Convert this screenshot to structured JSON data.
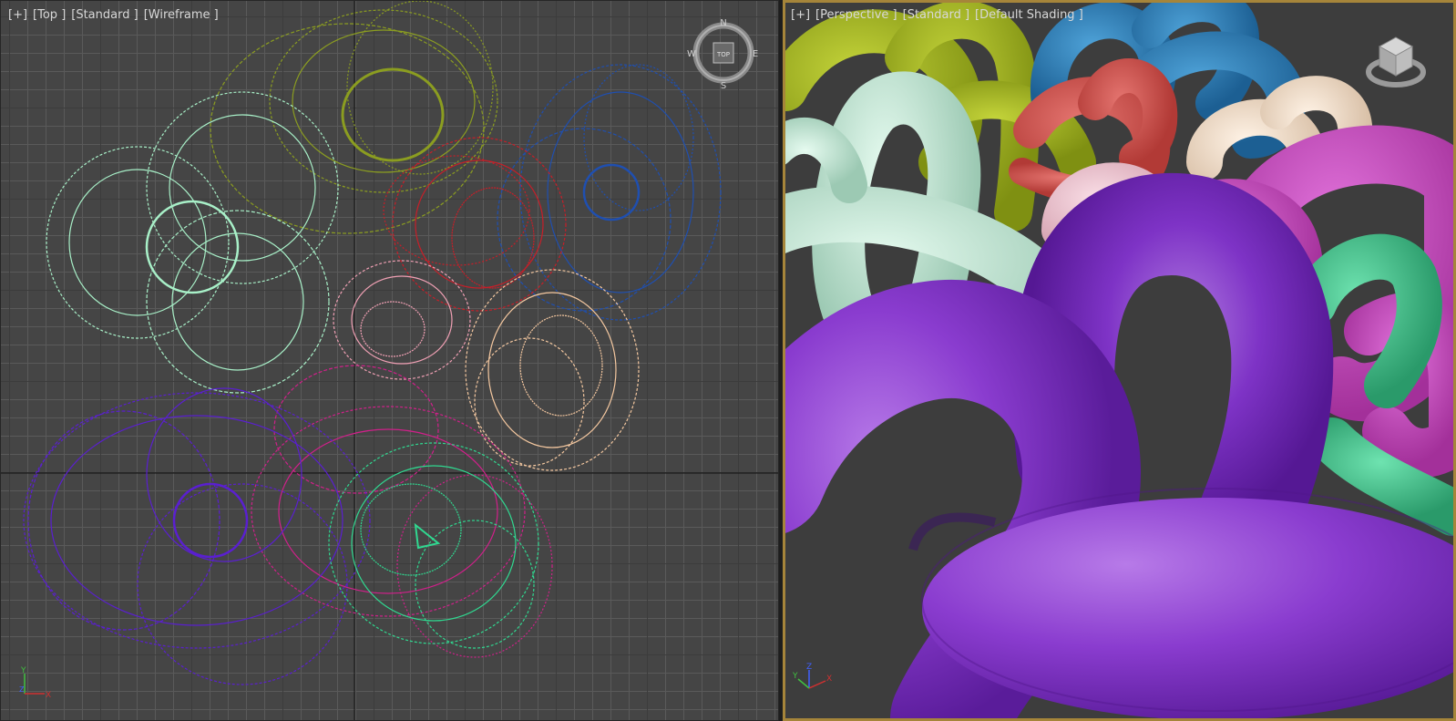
{
  "left_viewport": {
    "menu_plus": "[+]",
    "view_name": "[Top ]",
    "view_mode": "[Standard ]",
    "shading": "[Wireframe ]",
    "compass": {
      "n": "N",
      "e": "E",
      "s": "S",
      "w": "W",
      "center": "TOP"
    },
    "axis_y": "Y",
    "axis_z": "Z",
    "axis_x": "X"
  },
  "right_viewport": {
    "menu_plus": "[+]",
    "view_name": "[Perspective ]",
    "view_mode": "[Standard ]",
    "shading": "[Default Shading ]",
    "axis_y": "Y",
    "axis_z": "Z",
    "axis_x": "X"
  },
  "colors": {
    "active_border": "#a6853a",
    "grid_bg": "#454545",
    "wire_olive": "#8fa21f",
    "wire_mint": "#a8f0c8",
    "wire_blue": "#1f4fb0",
    "wire_red": "#c81e28",
    "wire_pink": "#f0a0b4",
    "wire_peach": "#f5c8a0",
    "wire_purple": "#5a1fd0",
    "wire_magenta": "#d0208a",
    "wire_green": "#30d890"
  }
}
